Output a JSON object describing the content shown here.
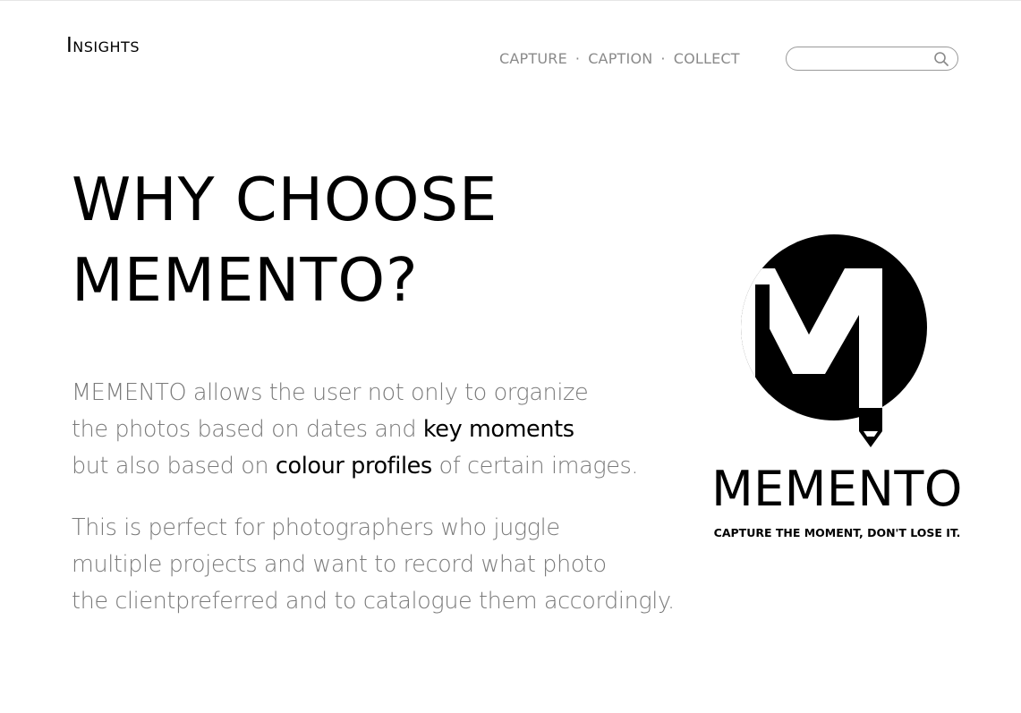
{
  "header": {
    "brand": "Insights",
    "nav": [
      {
        "label": "CAPTURE"
      },
      {
        "label": "CAPTION"
      },
      {
        "label": "COLLECT"
      }
    ],
    "nav_separator": "·",
    "search": {
      "value": "",
      "placeholder": "",
      "icon": "search-icon"
    }
  },
  "main": {
    "headline": [
      "WHY CHOOSE",
      "MEMENTO?"
    ],
    "paragraph1": {
      "line1": "MEMENTO allows the user not only to organize",
      "line2_pre": "the photos based on dates and ",
      "line2_strong": "key moments",
      "line3_pre": "but also based on ",
      "line3_strong": "colour profiles",
      "line3_post": " of certain images."
    },
    "paragraph2": {
      "lines": [
        "This is perfect for photographers who juggle",
        "multiple projects and want to record what photo",
        "the clientpreferred and to catalogue them accordingly."
      ]
    }
  },
  "logo": {
    "wordmark": "MEMENTO",
    "tagline": "CAPTURE THE MOMENT, DON'T LOSE IT.",
    "icon": "memento-logo-icon"
  },
  "colors": {
    "text": "#000000",
    "muted_text": "#7a7a7a",
    "nav_text": "#8a8a8a",
    "search_border": "#9a9a9a",
    "background": "#ffffff"
  }
}
